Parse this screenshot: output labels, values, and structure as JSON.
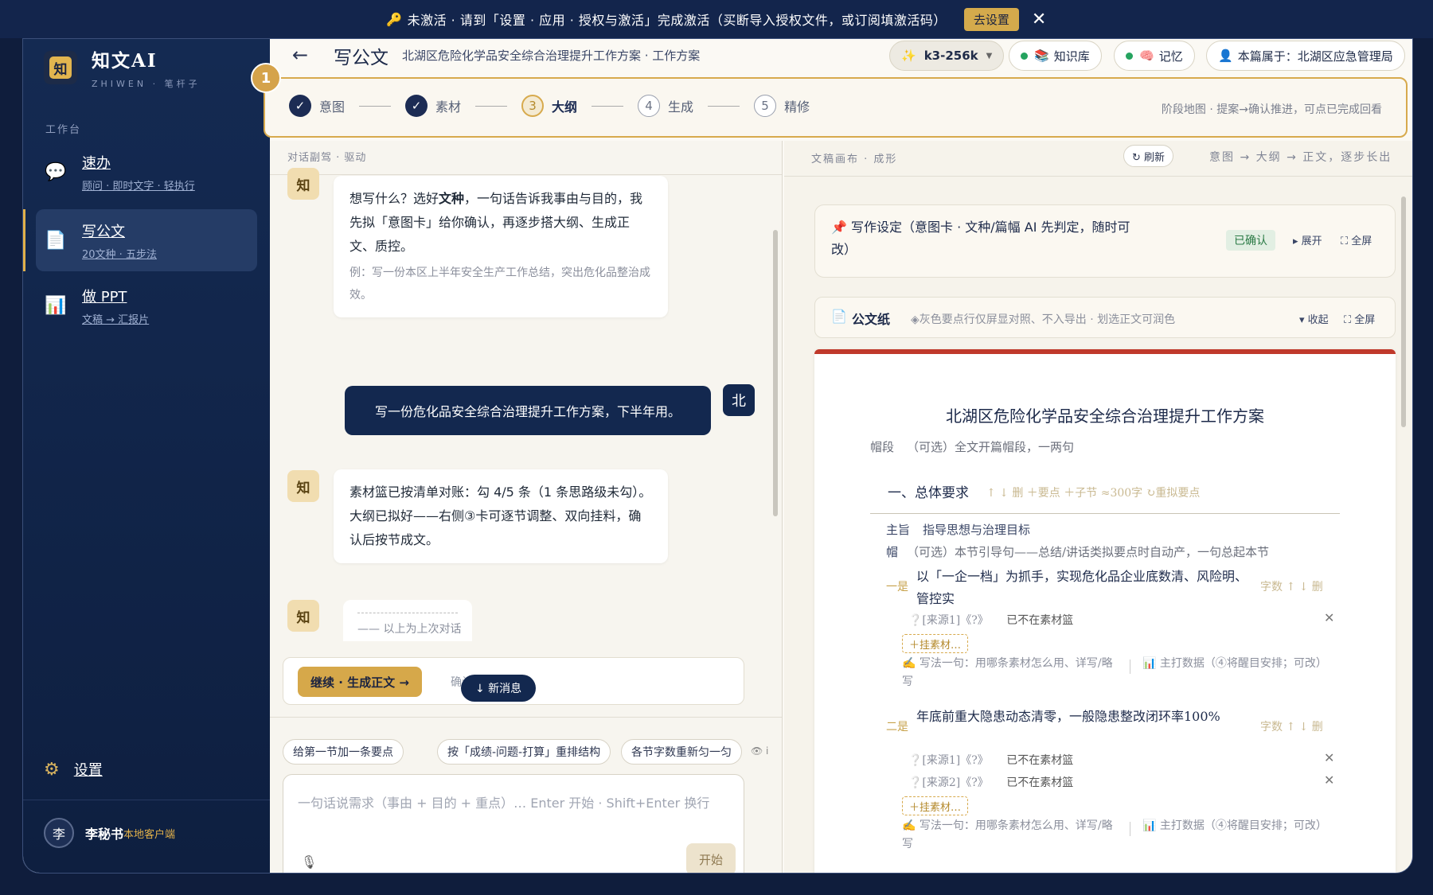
{
  "banner": {
    "text": "未激活 · 请到「设置 · 应用 · 授权与激活」完成激活（买断导入授权文件，或订阅填激活码）",
    "button": "去设置",
    "close": "✕",
    "key_icon": "🔑"
  },
  "sidebar": {
    "logo_char": "知",
    "app_name": "知文AI",
    "app_sub": "ZHIWEN · 笔杆子",
    "section_label": "工作台",
    "items": [
      {
        "icon": "💬",
        "label": "速办",
        "sub": "顾问 · 即时文字 · 轻执行"
      },
      {
        "icon": "📄",
        "label": "写公文",
        "sub": "20文种 · 五步法"
      },
      {
        "icon": "📊",
        "label": "做 PPT",
        "sub": "文稿 → 汇报片"
      }
    ],
    "settings_label": "设置",
    "settings_icon": "⚙",
    "user": {
      "avatar": "李",
      "name": "李秘书",
      "client": "本地客户端"
    }
  },
  "header": {
    "back": "←",
    "title": "写公文",
    "subtitle": "北湖区危险化学品安全综合治理提升工作方案 · 工作方案",
    "model": "k3-256k",
    "model_icon": "✨",
    "knowledge": "知识库",
    "memory": "记忆",
    "owner": "本篇属于：北湖区应急管理局"
  },
  "stepper": {
    "badge": "1",
    "steps": [
      {
        "num": "✓",
        "label": "意图",
        "state": "done"
      },
      {
        "num": "✓",
        "label": "素材",
        "state": "done"
      },
      {
        "num": "3",
        "label": "大纲",
        "state": "current"
      },
      {
        "num": "4",
        "label": "生成",
        "state": "todo"
      },
      {
        "num": "5",
        "label": "精修",
        "state": "todo"
      }
    ],
    "hint": "阶段地图 · 提案→确认推进，可点已完成回看"
  },
  "chat": {
    "header": "对话副驾 · 驱动",
    "bot_avatar": "知",
    "user_avatar": "北",
    "msg1_pre": "想写什么？选好",
    "msg1_bold": "文种",
    "msg1_post": "，一句话告诉我事由与目的，我先拟「意图卡」给你确认，再逐步搭大纲、生成正文、质控。",
    "msg1_example": "例：写一份本区上半年安全生产工作总结，突出危化品整治成效。",
    "user_msg": "写一份危化品安全综合治理提升工作方案，下半年用。",
    "msg2": "素材篮已按清单对账：勾 4/5 条（1 条思路级未勾）。大纲已拟好——右侧③卡可逐节调整、双向挂料，确认后按节成文。",
    "prev_note": "—— 以上为上次对话",
    "continue_btn": "继续 · 生成正文 →",
    "continue_hint": "确认后自动跳",
    "new_msg": "↓ 新消息",
    "suggestions": [
      "给第一节加一条要点",
      "按「成绩-问题-打算」重排结构",
      "各节字数重新匀一匀"
    ],
    "eye": "👁 i",
    "input_placeholder": "一句话说需求（事由 + 目的 + 重点）… Enter 开始 · Shift+Enter 换行",
    "mic": "🎙",
    "start": "开始"
  },
  "doc": {
    "header_left": "文稿画布 · 成形",
    "refresh": "↻ 刷新",
    "header_right": "意图 → 大纲 → 正文，逐步长出",
    "setting_title": "📌 写作设定（意图卡 · 文种/篇幅 AI 先判定，随时可改）",
    "confirmed": "已确认",
    "expand": "▸ 展开",
    "fullscreen": "⛶ 全屏",
    "paper_label": "公文纸",
    "paper_hint": "◈灰色要点行仅屏显对照、不入导出 · 划选正文可润色",
    "collapse": "▾ 收起",
    "fullscreen2": "⛶ 全屏",
    "title": "北湖区危险化学品安全综合治理提升工作方案",
    "cap_label": "帽段",
    "cap_text": "（可选）全文开篇帽段，一两句",
    "sec_title": "一、总体要求",
    "sec_ops": "↑ ↓ 删  ＋要点   ＋子节  ≈300字  ↻重拟要点",
    "gist_label": "主旨",
    "gist_text": "指导思想与治理目标",
    "cap2_label": "帽",
    "cap2_text": "（可选）本节引导句——总结/讲话类拟要点时自动产，一句总起本节",
    "points": [
      {
        "label": "一是",
        "text": "以「一企一档」为抓手，实现危化品企业底数清、风险明、管控实"
      },
      {
        "label": "二是",
        "text": "年底前重大隐患动态清零，一般隐患整改闭环率100%"
      }
    ],
    "point_ops": "字数  ↑  ↓  删",
    "src_missing": "已不在素材篮",
    "src1": "❔[来源1]《?》",
    "src2": "❔[来源2]《?》",
    "attach": "＋挂素材…",
    "howto": "✍ 写法一句：用哪条素材怎么用、详写/略写",
    "keydata": "📊 主打数据（④将醒目安排；可改）",
    "x": "✕"
  }
}
